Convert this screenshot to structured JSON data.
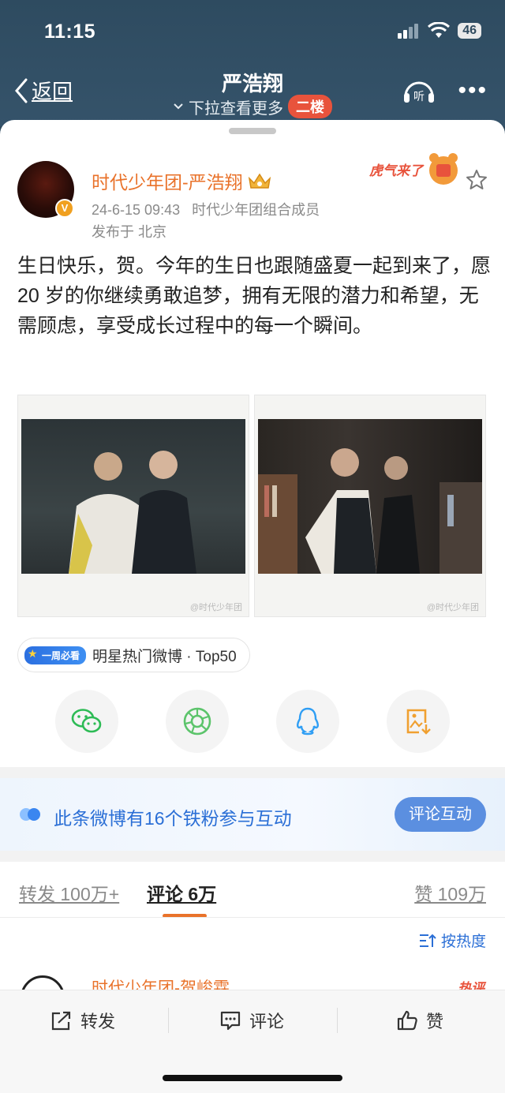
{
  "status_bar": {
    "time": "11:15",
    "battery": "46"
  },
  "nav": {
    "back_label": "返回",
    "title": "严浩翔",
    "subtitle": "下拉查看更多",
    "floor_badge": "二楼",
    "listen_label": "听"
  },
  "post": {
    "author": "时代少年团-严浩翔",
    "verified_mark": "V",
    "datetime": "24-6-15 09:43",
    "source": "时代少年团组合成员",
    "location": "发布于 北京",
    "sticker_text": "虎气来了",
    "text": "生日快乐，贺。今年的生日也跟随盛夏一起到来了，愿 20 岁的你继续勇敢追梦，拥有无限的潜力和希望，无需顾虑，享受成长过程中的每一个瞬间。",
    "photos": [
      {
        "watermark": "@时代少年团"
      },
      {
        "watermark": "@时代少年团"
      }
    ],
    "hot_tag": {
      "badge": "一周必看",
      "label": "明星热门微博 · Top50"
    }
  },
  "share": {
    "items": [
      "wechat-icon",
      "moments-icon",
      "qq-icon",
      "save-image-icon"
    ]
  },
  "fans_banner": {
    "text": "此条微博有16个铁粉参与互动",
    "button": "评论互动"
  },
  "tabs": {
    "repost": "转发 100万+",
    "comment": "评论 6万",
    "like": "赞 109万"
  },
  "sort_label": "按热度",
  "comment_preview": {
    "author": "时代少年团-贺峻霖",
    "hot_label": "热评"
  },
  "bottom_bar": {
    "repost": "转发",
    "comment": "评论",
    "like": "赞"
  },
  "colors": {
    "accent_orange": "#e9722a",
    "link_blue": "#2b6fd6",
    "header_bg": "#2f4a5e"
  }
}
